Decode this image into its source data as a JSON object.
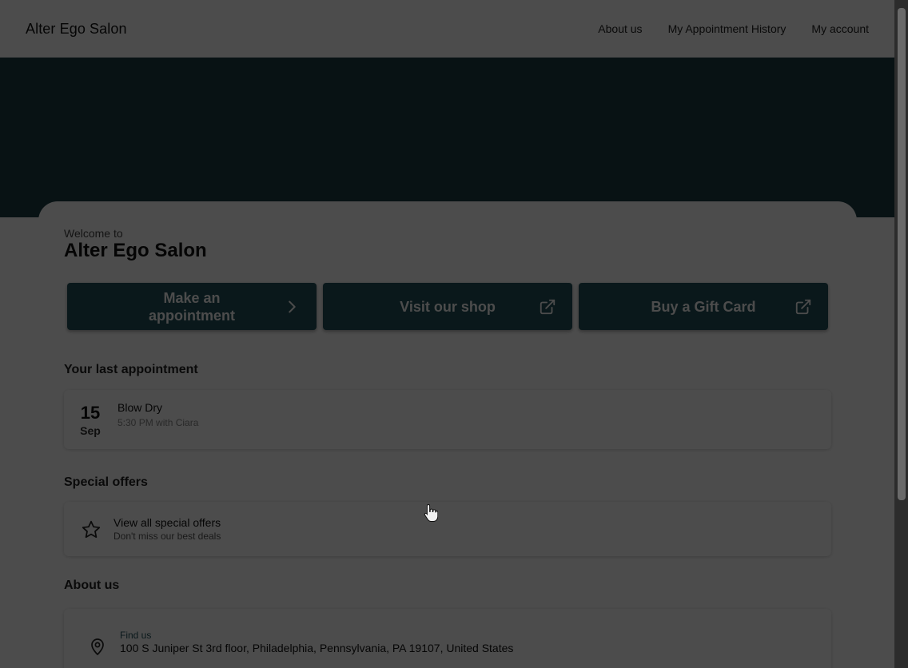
{
  "header": {
    "brand": "Alter Ego Salon",
    "nav": [
      "About us",
      "My Appointment History",
      "My account"
    ]
  },
  "welcome": {
    "subtitle": "Welcome to",
    "title": "Alter Ego Salon"
  },
  "actions": [
    {
      "label": "Make an appointment",
      "icon": "chevron-right-icon"
    },
    {
      "label": "Visit our shop",
      "icon": "external-link-icon"
    },
    {
      "label": "Buy a Gift Card",
      "icon": "external-link-icon"
    }
  ],
  "last_appointment": {
    "heading": "Your last appointment",
    "day": "15",
    "month": "Sep",
    "service": "Blow Dry",
    "meta": "5:30 PM with Ciara"
  },
  "special_offers": {
    "heading": "Special offers",
    "title": "View all special offers",
    "subtitle": "Don't miss our best deals",
    "icon": "star-icon"
  },
  "about": {
    "heading": "About us",
    "find_label": "Find us",
    "address": "100 S Juniper St 3rd floor, Philadelphia, Pennsylvania, PA 19107, United States",
    "icon": "map-pin-icon"
  },
  "colors": {
    "hero": "#1b3c44",
    "button": "#24535b",
    "overlay": "rgba(0,0,0,0.70)"
  }
}
